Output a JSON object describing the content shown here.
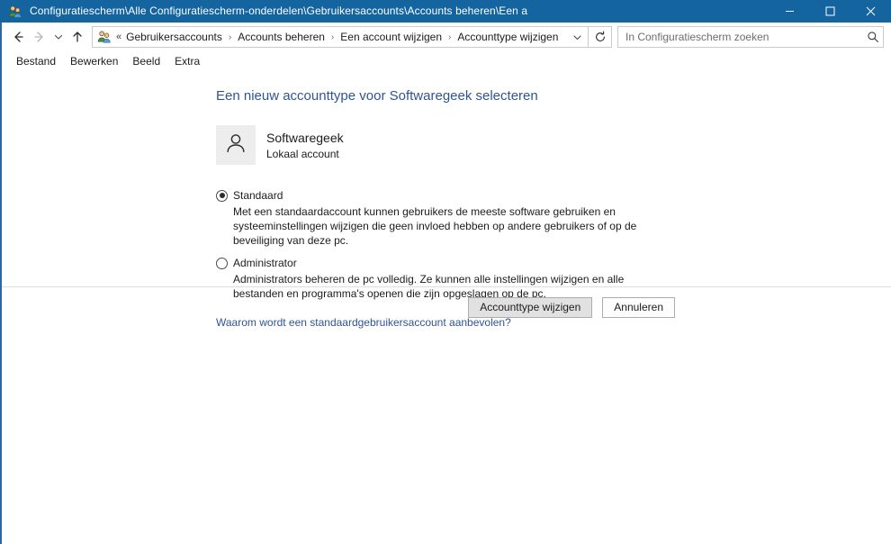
{
  "window": {
    "title": "Configuratiescherm\\Alle Configuratiescherm-onderdelen\\Gebruikersaccounts\\Accounts beheren\\Een a",
    "icon": "user-accounts-icon",
    "accent_color": "#1464a0",
    "controls": {
      "minimize": "minimize-icon",
      "maximize": "maximize-icon",
      "close": "close-icon"
    }
  },
  "navbar": {
    "back": "back-arrow-icon",
    "forward": "forward-arrow-icon",
    "recent": "chevron-down-icon",
    "up": "up-arrow-icon",
    "address_icon": "user-accounts-icon",
    "overflow": "«",
    "breadcrumbs": [
      "Gebruikersaccounts",
      "Accounts beheren",
      "Een account wijzigen",
      "Accounttype wijzigen"
    ],
    "separator": "›",
    "dropdown": "chevron-down-icon",
    "refresh": "refresh-icon"
  },
  "search": {
    "placeholder": "In Configuratiescherm zoeken",
    "value": "",
    "icon": "search-icon"
  },
  "menubar": {
    "items": [
      {
        "label": "Bestand"
      },
      {
        "label": "Bewerken"
      },
      {
        "label": "Beeld"
      },
      {
        "label": "Extra"
      }
    ]
  },
  "main": {
    "heading": "Een nieuw accounttype voor Softwaregeek selecteren",
    "heading_color": "#2f5496",
    "user": {
      "avatar_icon": "person-icon",
      "name": "Softwaregeek",
      "account_type": "Lokaal account"
    },
    "options": [
      {
        "label": "Standaard",
        "selected": true,
        "description": "Met een standaardaccount kunnen gebruikers de meeste software gebruiken en systeeminstellingen wijzigen die geen invloed hebben op andere gebruikers of op de beveiliging van deze pc."
      },
      {
        "label": "Administrator",
        "selected": false,
        "description": "Administrators beheren de pc volledig. Ze kunnen alle instellingen wijzigen en alle bestanden en programma's openen die zijn opgeslagen op de pc."
      }
    ],
    "help_link": "Waarom wordt een standaardgebruikersaccount aanbevolen?"
  },
  "footer": {
    "primary_label": "Accounttype wijzigen",
    "secondary_label": "Annuleren"
  }
}
